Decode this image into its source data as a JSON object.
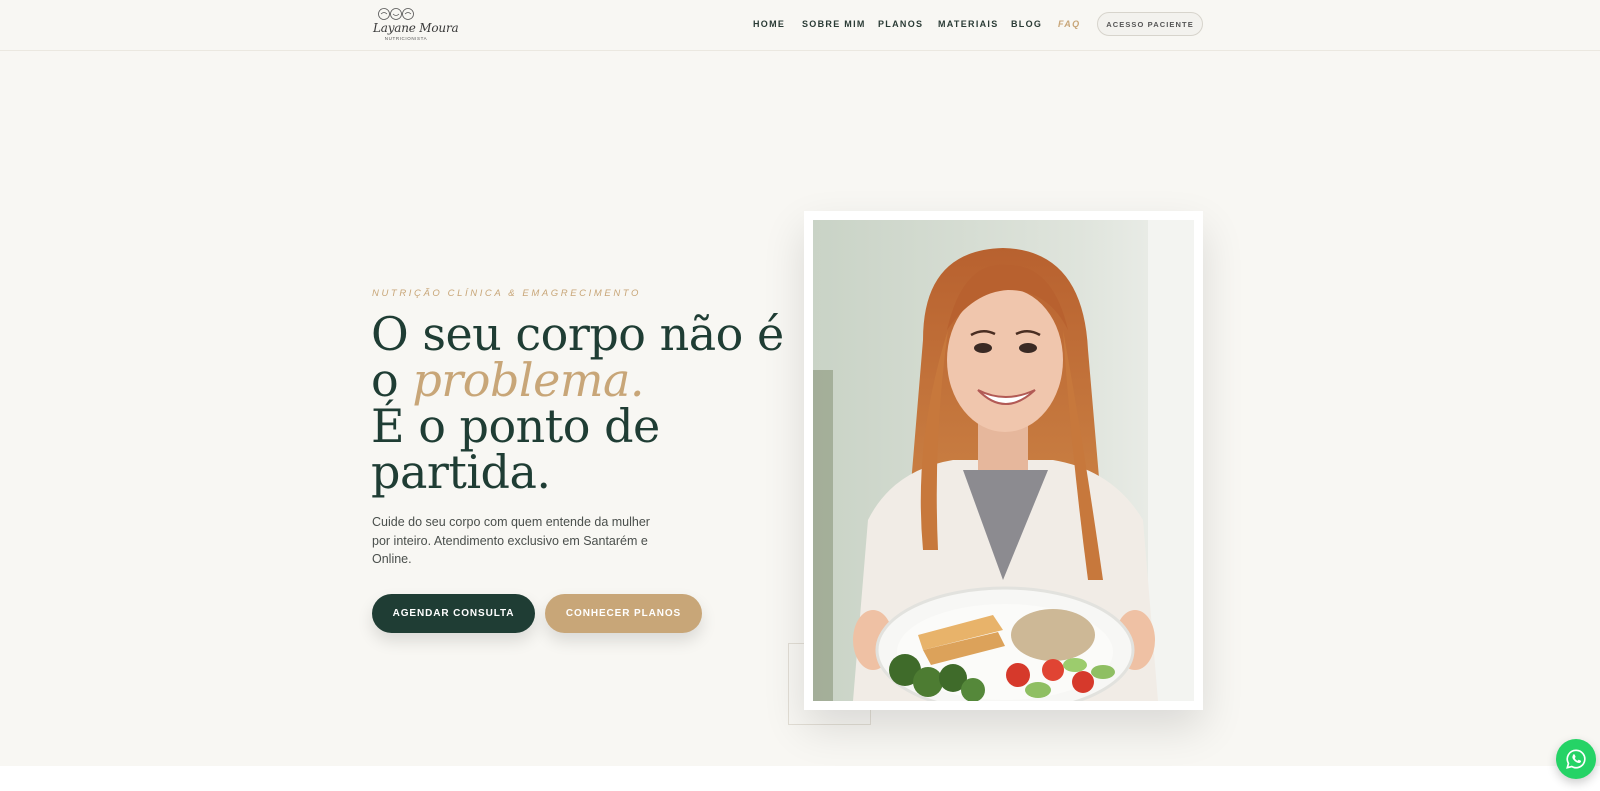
{
  "brand": {
    "logo_name": "Layane Moura",
    "logo_sub": "NUTRICIONISTA",
    "colors": {
      "green": "#1f3d34",
      "gold": "#c8a678",
      "whatsapp": "#25d366"
    }
  },
  "nav": {
    "items": [
      {
        "label": "HOME"
      },
      {
        "label": "SOBRE MIM"
      },
      {
        "label": "PLANOS"
      },
      {
        "label": "MATERIAIS"
      },
      {
        "label": "BLOG"
      },
      {
        "label": "FAQ",
        "active": true
      }
    ],
    "access_button": "ACESSO PACIENTE"
  },
  "hero": {
    "eyebrow": "NUTRIÇÃO CLÍNICA & EMAGRECIMENTO",
    "headline": {
      "line1": "O seu corpo não é",
      "line2_prefix": "o ",
      "line2_accent": "problema.",
      "line3": "É o ponto de",
      "line4": "partida."
    },
    "subtitle": "Cuide do seu corpo com quem entende da mulher por inteiro. Atendimento exclusivo em Santarém e Online.",
    "primary_button": "AGENDAR CONSULTA",
    "secondary_button": "CONHECER PLANOS"
  },
  "floating": {
    "whatsapp_icon": "whatsapp-icon"
  }
}
